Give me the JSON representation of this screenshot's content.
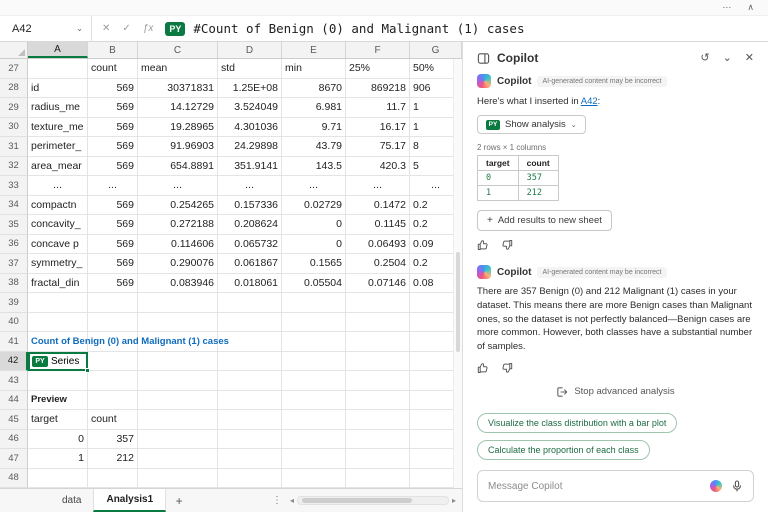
{
  "titlebar": {
    "more_icon": "⋯",
    "collapse_icon": "∧"
  },
  "formula_bar": {
    "cell_ref": "A42",
    "chevron_icon": "⌄",
    "cancel_icon": "✕",
    "enter_icon": "✓",
    "fx_icon": "ƒx",
    "py_badge": "PY",
    "formula": "#Count of Benign (0) and Malignant (1) cases"
  },
  "sheet": {
    "columns": [
      "A",
      "B",
      "C",
      "D",
      "E",
      "F",
      "G"
    ],
    "selected_column": "A",
    "selected_row": 42,
    "py_badge": "PY",
    "rows": [
      {
        "n": 27,
        "cells": [
          [
            "",
            "l"
          ],
          [
            "count",
            "l"
          ],
          [
            "mean",
            "l"
          ],
          [
            "std",
            "l"
          ],
          [
            "min",
            "l"
          ],
          [
            "25%",
            "l"
          ],
          [
            "50%",
            "l"
          ]
        ]
      },
      {
        "n": 28,
        "cells": [
          [
            "id",
            "l"
          ],
          [
            "569",
            "r"
          ],
          [
            "30371831",
            "r"
          ],
          [
            "1.25E+08",
            "r"
          ],
          [
            "8670",
            "r"
          ],
          [
            "869218",
            "r"
          ],
          [
            "906",
            "l"
          ]
        ]
      },
      {
        "n": 29,
        "cells": [
          [
            "radius_me",
            "l"
          ],
          [
            "569",
            "r"
          ],
          [
            "14.12729",
            "r"
          ],
          [
            "3.524049",
            "r"
          ],
          [
            "6.981",
            "r"
          ],
          [
            "11.7",
            "r"
          ],
          [
            "1",
            "l"
          ]
        ]
      },
      {
        "n": 30,
        "cells": [
          [
            "texture_me",
            "l"
          ],
          [
            "569",
            "r"
          ],
          [
            "19.28965",
            "r"
          ],
          [
            "4.301036",
            "r"
          ],
          [
            "9.71",
            "r"
          ],
          [
            "16.17",
            "r"
          ],
          [
            "1",
            "l"
          ]
        ]
      },
      {
        "n": 31,
        "cells": [
          [
            "perimeter_",
            "l"
          ],
          [
            "569",
            "r"
          ],
          [
            "91.96903",
            "r"
          ],
          [
            "24.29898",
            "r"
          ],
          [
            "43.79",
            "r"
          ],
          [
            "75.17",
            "r"
          ],
          [
            "8",
            "l"
          ]
        ]
      },
      {
        "n": 32,
        "cells": [
          [
            "area_mear",
            "l"
          ],
          [
            "569",
            "r"
          ],
          [
            "654.8891",
            "r"
          ],
          [
            "351.9141",
            "r"
          ],
          [
            "143.5",
            "r"
          ],
          [
            "420.3",
            "r"
          ],
          [
            "5",
            "l"
          ]
        ]
      },
      {
        "n": 33,
        "cells": [
          [
            "...",
            "c"
          ],
          [
            "...",
            "c"
          ],
          [
            "...",
            "c"
          ],
          [
            "...",
            "c"
          ],
          [
            "...",
            "c"
          ],
          [
            "...",
            "c"
          ],
          [
            "...",
            "c"
          ]
        ]
      },
      {
        "n": 34,
        "cells": [
          [
            "compactn",
            "l"
          ],
          [
            "569",
            "r"
          ],
          [
            "0.254265",
            "r"
          ],
          [
            "0.157336",
            "r"
          ],
          [
            "0.02729",
            "r"
          ],
          [
            "0.1472",
            "r"
          ],
          [
            "0.2",
            "l"
          ]
        ]
      },
      {
        "n": 35,
        "cells": [
          [
            "concavity_",
            "l"
          ],
          [
            "569",
            "r"
          ],
          [
            "0.272188",
            "r"
          ],
          [
            "0.208624",
            "r"
          ],
          [
            "0",
            "r"
          ],
          [
            "0.1145",
            "r"
          ],
          [
            "0.2",
            "l"
          ]
        ]
      },
      {
        "n": 36,
        "cells": [
          [
            "concave p",
            "l"
          ],
          [
            "569",
            "r"
          ],
          [
            "0.114606",
            "r"
          ],
          [
            "0.065732",
            "r"
          ],
          [
            "0",
            "r"
          ],
          [
            "0.06493",
            "r"
          ],
          [
            "0.09",
            "l"
          ]
        ]
      },
      {
        "n": 37,
        "cells": [
          [
            "symmetry_",
            "l"
          ],
          [
            "569",
            "r"
          ],
          [
            "0.290076",
            "r"
          ],
          [
            "0.061867",
            "r"
          ],
          [
            "0.1565",
            "r"
          ],
          [
            "0.2504",
            "r"
          ],
          [
            "0.2",
            "l"
          ]
        ]
      },
      {
        "n": 38,
        "cells": [
          [
            "fractal_din",
            "l"
          ],
          [
            "569",
            "r"
          ],
          [
            "0.083946",
            "r"
          ],
          [
            "0.018061",
            "r"
          ],
          [
            "0.05504",
            "r"
          ],
          [
            "0.07146",
            "r"
          ],
          [
            "0.08",
            "l"
          ]
        ]
      },
      {
        "n": 39,
        "cells": []
      },
      {
        "n": 40,
        "cells": []
      },
      {
        "n": 41,
        "type": "title",
        "text": "Count of Benign (0) and Malignant (1) cases"
      },
      {
        "n": 42,
        "type": "py",
        "text": "Series"
      },
      {
        "n": 43,
        "cells": []
      },
      {
        "n": 44,
        "type": "bold",
        "text": "Preview"
      },
      {
        "n": 45,
        "cells": [
          [
            "target",
            "l"
          ],
          [
            "count",
            "l"
          ],
          [
            "",
            "l"
          ],
          [
            "",
            "l"
          ],
          [
            "",
            "l"
          ],
          [
            "",
            "l"
          ],
          [
            "",
            "l"
          ]
        ]
      },
      {
        "n": 46,
        "cells": [
          [
            "0",
            "r"
          ],
          [
            "357",
            "r"
          ],
          [
            "",
            "l"
          ],
          [
            "",
            "l"
          ],
          [
            "",
            "l"
          ],
          [
            "",
            "l"
          ],
          [
            "",
            "l"
          ]
        ]
      },
      {
        "n": 47,
        "cells": [
          [
            "1",
            "r"
          ],
          [
            "212",
            "r"
          ],
          [
            "",
            "l"
          ],
          [
            "",
            "l"
          ],
          [
            "",
            "l"
          ],
          [
            "",
            "l"
          ],
          [
            "",
            "l"
          ]
        ]
      },
      {
        "n": 48,
        "cells": []
      }
    ]
  },
  "tabbar": {
    "tabs": [
      {
        "label": "data",
        "active": false
      },
      {
        "label": "Analysis1",
        "active": true
      }
    ],
    "add_icon": "+",
    "menu_icon": "⋮",
    "scroll_left_icon": "◂",
    "scroll_right_icon": "▸"
  },
  "copilot": {
    "pane_title": "Copilot",
    "history_icon": "↺",
    "chevron_icon": "⌄",
    "close_icon": "✕",
    "msg1": {
      "author": "Copilot",
      "disclaimer": "AI-generated content may be incorrect",
      "intro_prefix": "Here's what I inserted in ",
      "intro_link": "A42",
      "intro_suffix": ":",
      "py_badge": "PY",
      "show_analysis_label": "Show analysis",
      "show_analysis_chevron": "⌄",
      "dims": "2 rows × 1 columns",
      "table": {
        "headers": [
          "target",
          "count"
        ],
        "rows": [
          [
            "0",
            "357"
          ],
          [
            "1",
            "212"
          ]
        ]
      },
      "add_icon": "+",
      "add_button": "Add results to new sheet"
    },
    "msg2": {
      "author": "Copilot",
      "disclaimer": "AI-generated content may be incorrect",
      "text": "There are 357 Benign (0) and 212 Malignant (1) cases in your dataset. This means there are more Benign cases than Malignant ones, so the dataset is not perfectly balanced—Benign cases are more common. However, both classes have a substantial number of samples."
    },
    "stop_button": "Stop advanced analysis",
    "suggestions": [
      "Visualize the class distribution with a bar plot",
      "Calculate the proportion of each class"
    ],
    "input_placeholder": "Message Copilot"
  }
}
